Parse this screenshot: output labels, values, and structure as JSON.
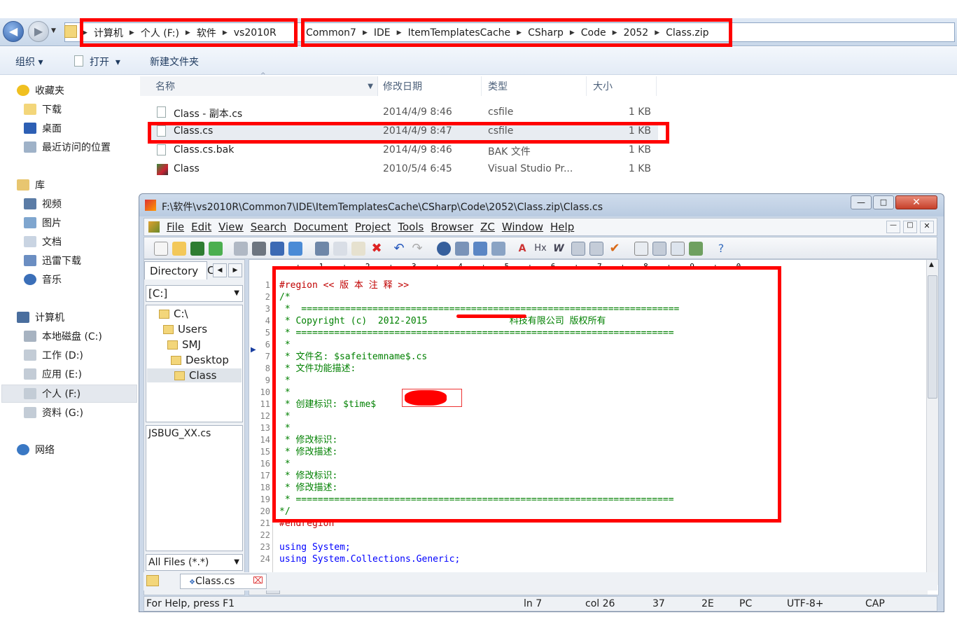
{
  "address": {
    "crumbs_left": [
      "计算机",
      "个人 (F:)",
      "软件",
      "vs2010R"
    ],
    "crumbs_right": [
      "Common7",
      "IDE",
      "ItemTemplatesCache",
      "CSharp",
      "Code",
      "2052",
      "Class.zip"
    ]
  },
  "toolbar": {
    "organize": "组织",
    "open": "打开",
    "new_folder": "新建文件夹"
  },
  "nav": {
    "favorites": "收藏夹",
    "downloads": "下载",
    "desktop": "桌面",
    "recent": "最近访问的位置",
    "library": "库",
    "video": "视频",
    "pictures": "图片",
    "documents": "文档",
    "thunder": "迅雷下载",
    "music": "音乐",
    "computer": "计算机",
    "drive_c": "本地磁盘 (C:)",
    "drive_d": "工作 (D:)",
    "drive_e": "应用 (E:)",
    "drive_f": "个人 (F:)",
    "drive_g": "资料 (G:)",
    "network": "网络"
  },
  "columns": {
    "name": "名称",
    "date": "修改日期",
    "type": "类型",
    "size": "大小"
  },
  "files": [
    {
      "name": "Class - 副本.cs",
      "date": "2014/4/9 8:46",
      "type": "csfile",
      "size": "1 KB"
    },
    {
      "name": "Class.cs",
      "date": "2014/4/9 8:47",
      "type": "csfile",
      "size": "1 KB"
    },
    {
      "name": "Class.cs.bak",
      "date": "2014/4/9 8:46",
      "type": "BAK 文件",
      "size": "1 KB"
    },
    {
      "name": "Class",
      "date": "2010/5/4 6:45",
      "type": "Visual Studio Pr...",
      "size": "1 KB"
    }
  ],
  "editor": {
    "title": "F:\\软件\\vs2010R\\Common7\\IDE\\ItemTemplatesCache\\CSharp\\Code\\2052\\Class.zip\\Class.cs",
    "menu": [
      "File",
      "Edit",
      "View",
      "Search",
      "Document",
      "Project",
      "Tools",
      "Browser",
      "ZC",
      "Window",
      "Help"
    ],
    "dir_tab": "Directory",
    "dir_tab2": "C",
    "drive": "[C:]",
    "tree": [
      "C:\\",
      "Users",
      "SMJ",
      "Desktop",
      "Class"
    ],
    "file_list": "JSBUG_XX.cs",
    "filter": "All Files (*.*)",
    "doc_tab": "Class.cs",
    "ruler": "----+----1----+----2----+----3----+----4----+----5----+----6----+----7----+----8----+----9----+----0---",
    "lines": [
      "#region << 版 本 注 释 >>",
      "/*",
      " *  =====================================================================",
      " * Copyright (c)  2012-2015               科技有限公司 版权所有",
      " * =====================================================================",
      " *",
      " * 文件名: $safeitemname$.cs",
      " * 文件功能描述:",
      " *",
      " *",
      " * 创建标识: $time$",
      " *",
      " *",
      " * 修改标识:",
      " * 修改描述:",
      " *",
      " * 修改标识:",
      " * 修改描述:",
      " * =====================================================================",
      "*/",
      "#endregion",
      "",
      "using System;",
      "using System.Collections.Generic;"
    ],
    "line_numbers": [
      "1",
      "2",
      "3",
      "4",
      "5",
      "6",
      "7",
      "8",
      "9",
      "10",
      "11",
      "12",
      "13",
      "14",
      "15",
      "16",
      "17",
      "18",
      "19",
      "20",
      "21",
      "22",
      "23",
      "24"
    ],
    "status": {
      "help": "For Help, press F1",
      "ln": "ln 7",
      "col": "col 26",
      "n1": "37",
      "n2": "2E",
      "mode": "PC",
      "enc": "UTF-8+",
      "cap": "CAP"
    }
  },
  "colors": {
    "highlight": "#ff0000",
    "comment": "#008000",
    "keyword": "#0000ff",
    "region": "#c00000"
  }
}
